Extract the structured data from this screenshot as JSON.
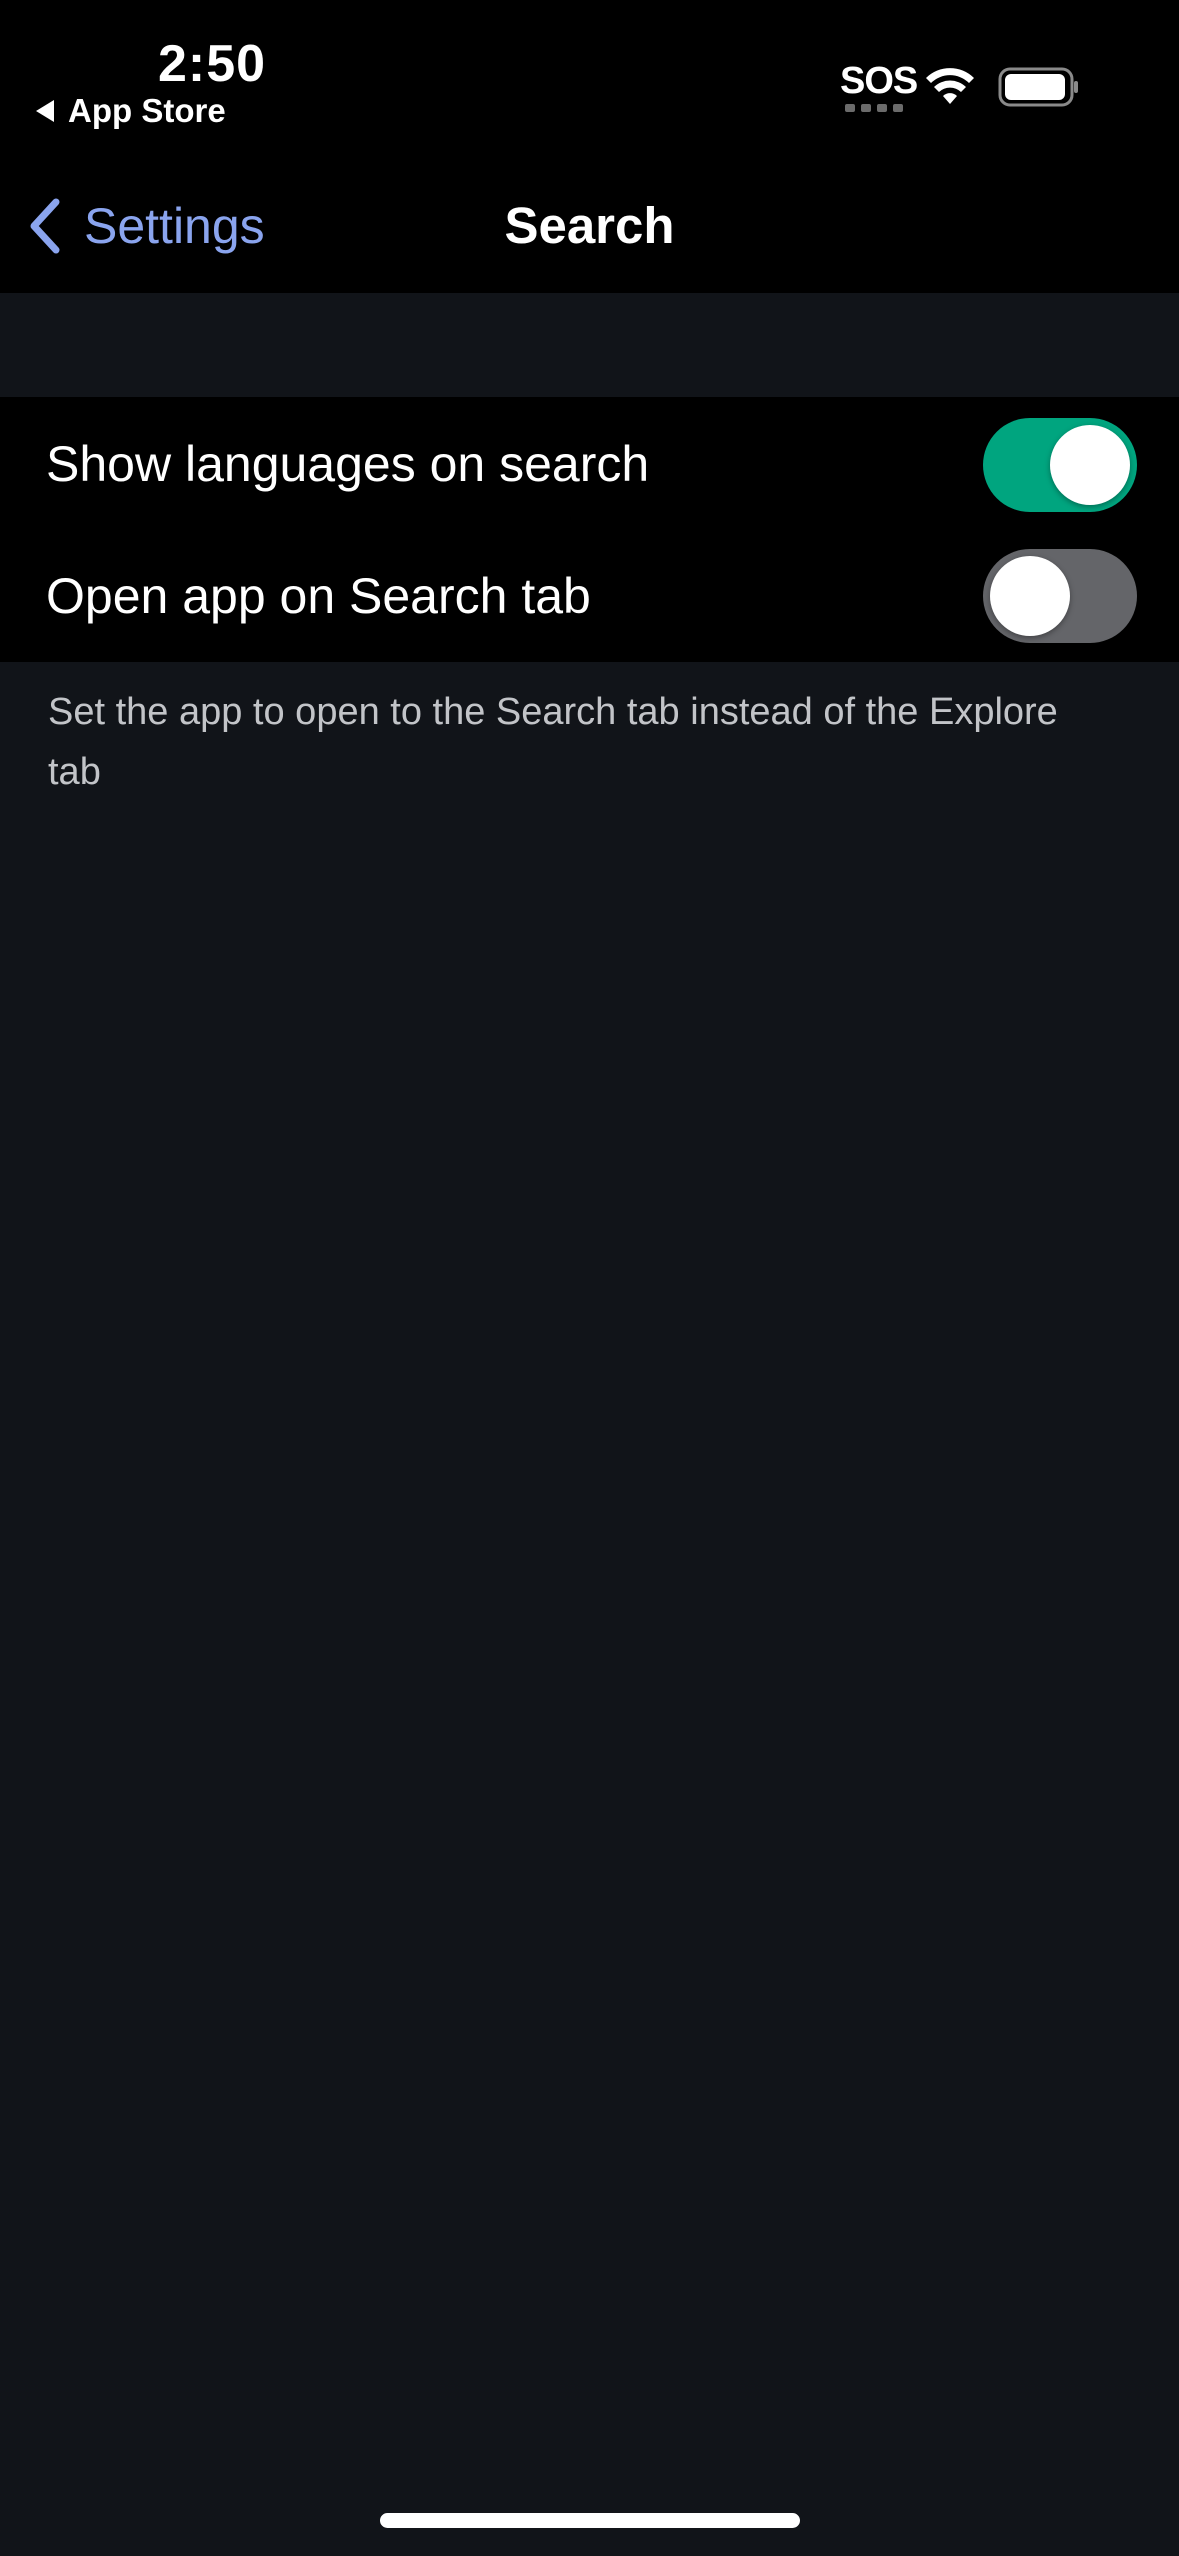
{
  "status_bar": {
    "time": "2:50",
    "back_app": "App Store",
    "sos": "SOS",
    "wifi_icon": "wifi-icon",
    "battery_icon": "battery-icon"
  },
  "nav": {
    "back_label": "Settings",
    "title": "Search",
    "back_color": "#8aa4ee"
  },
  "settings": {
    "rows": [
      {
        "label": "Show languages on search",
        "enabled": true
      },
      {
        "label": "Open app on Search tab",
        "enabled": false
      }
    ],
    "footnote": "Set the app to open to the Search tab instead of the Explore tab"
  },
  "colors": {
    "toggle_on": "#00a57f",
    "toggle_off": "#646569",
    "background": "#111419"
  }
}
